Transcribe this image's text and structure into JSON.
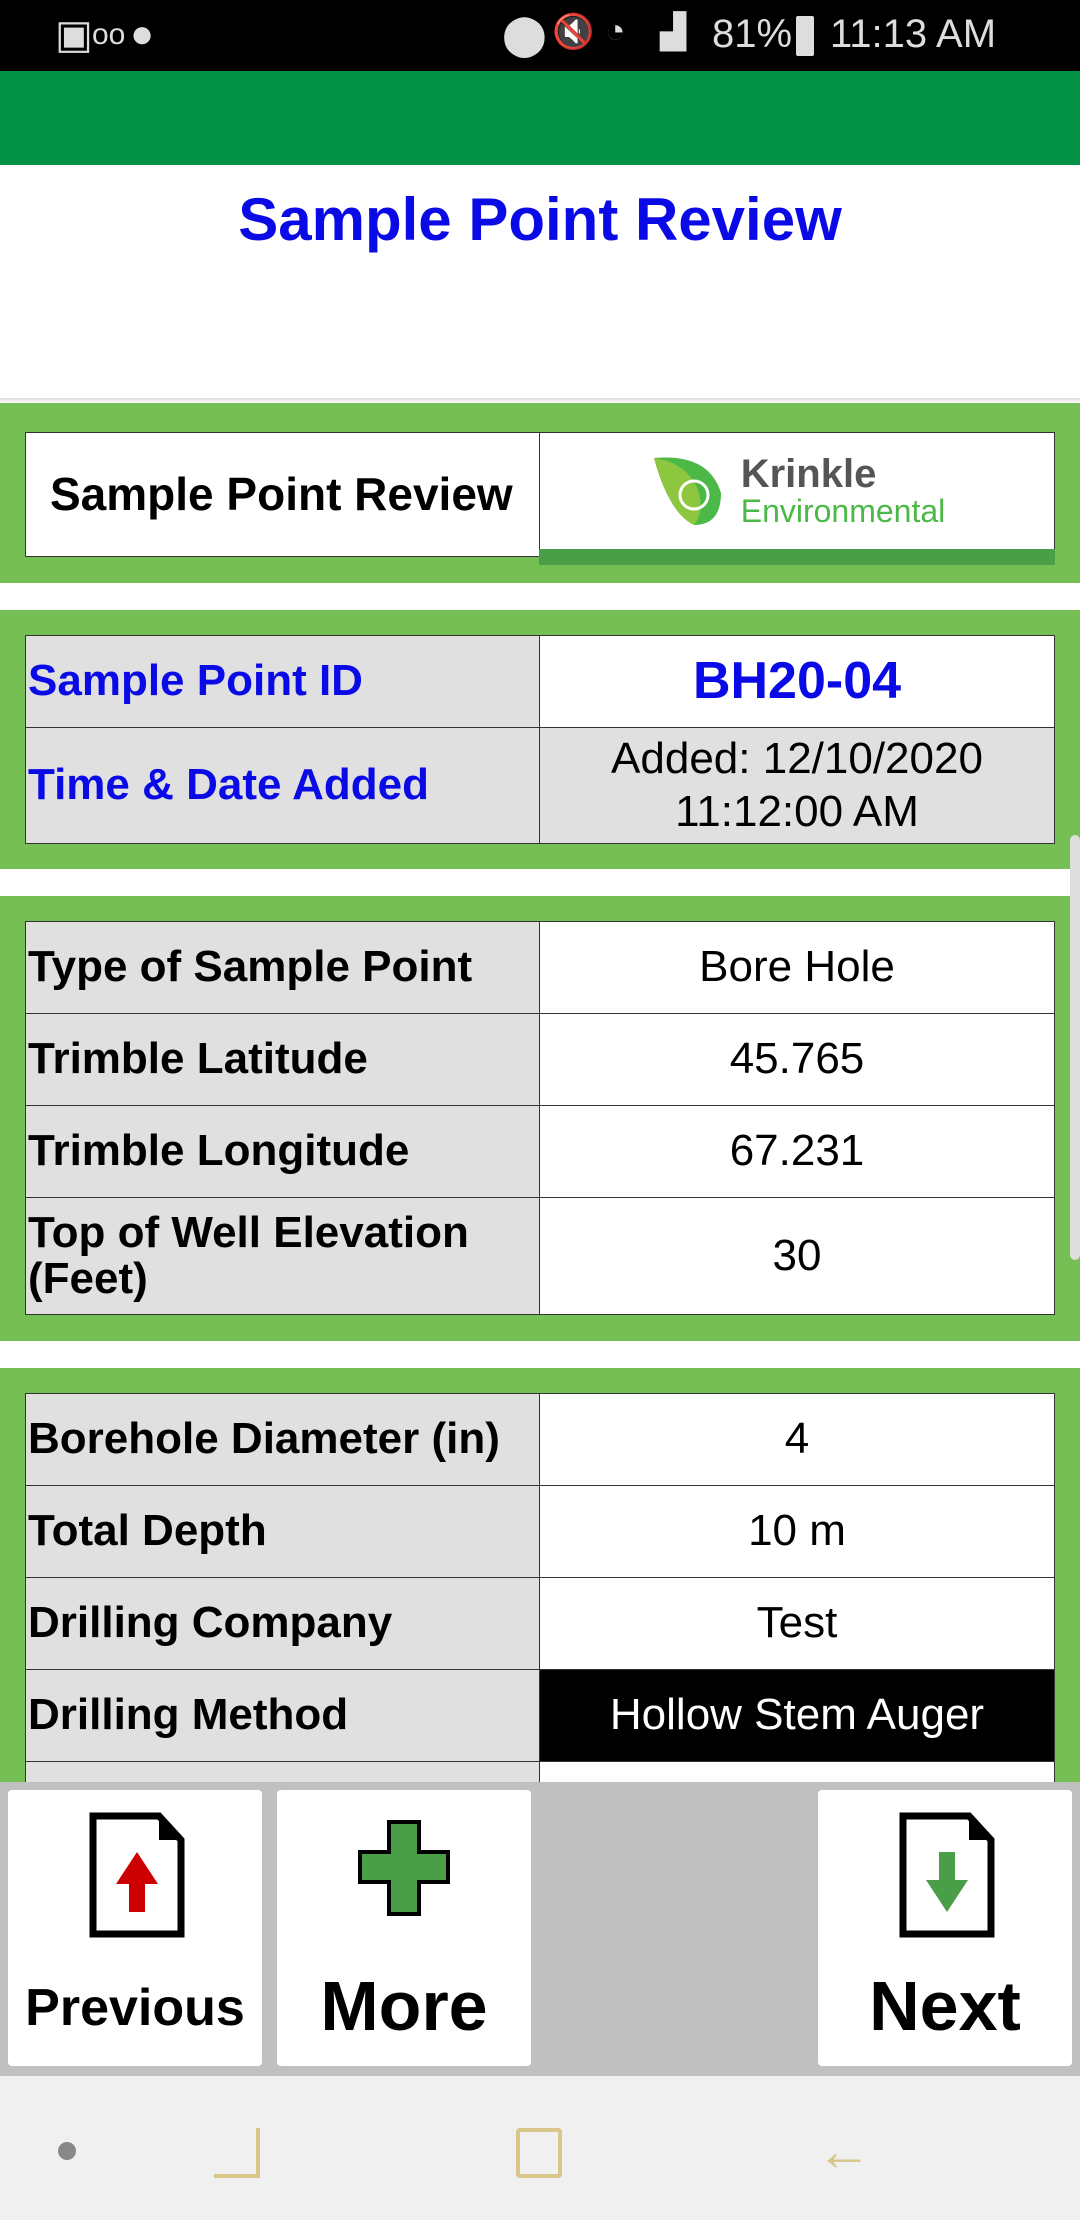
{
  "status_bar": {
    "battery": "81%",
    "time": "11:13 AM",
    "icons": [
      "gallery-icon",
      "voicemail-icon",
      "shazam-icon",
      "location-icon",
      "mute-icon",
      "wifi-icon",
      "signal-icon",
      "battery-icon"
    ]
  },
  "page": {
    "title": "Sample Point Review"
  },
  "header_panel": {
    "label": "Sample Point Review",
    "logo_name": "Krinkle",
    "logo_sub": "Environmental"
  },
  "id_panel": [
    {
      "label": "Sample Point ID",
      "value": "BH20-04"
    },
    {
      "label": "Time & Date Added",
      "value_line1": "Added: 12/10/2020",
      "value_line2": "11:12:00 AM"
    }
  ],
  "details": [
    {
      "label": "Type of Sample Point",
      "value": "Bore Hole"
    },
    {
      "label": "Trimble Latitude",
      "value": "45.765"
    },
    {
      "label": "Trimble Longitude",
      "value": "67.231"
    },
    {
      "label": "Top of Well Elevation (Feet)",
      "value": "30"
    }
  ],
  "drilling": [
    {
      "label": "Borehole Diameter (in)",
      "value": "4"
    },
    {
      "label": "Total Depth",
      "value": "10 m"
    },
    {
      "label": "Drilling Company",
      "value": "Test"
    },
    {
      "label": "Drilling Method",
      "value": "Hollow Stem Auger"
    }
  ],
  "buttons": {
    "previous": "Previous",
    "more": "More",
    "next": "Next"
  },
  "colors": {
    "app_bar": "#029145",
    "panel": "#75bf55",
    "title": "#0a0ae6"
  }
}
